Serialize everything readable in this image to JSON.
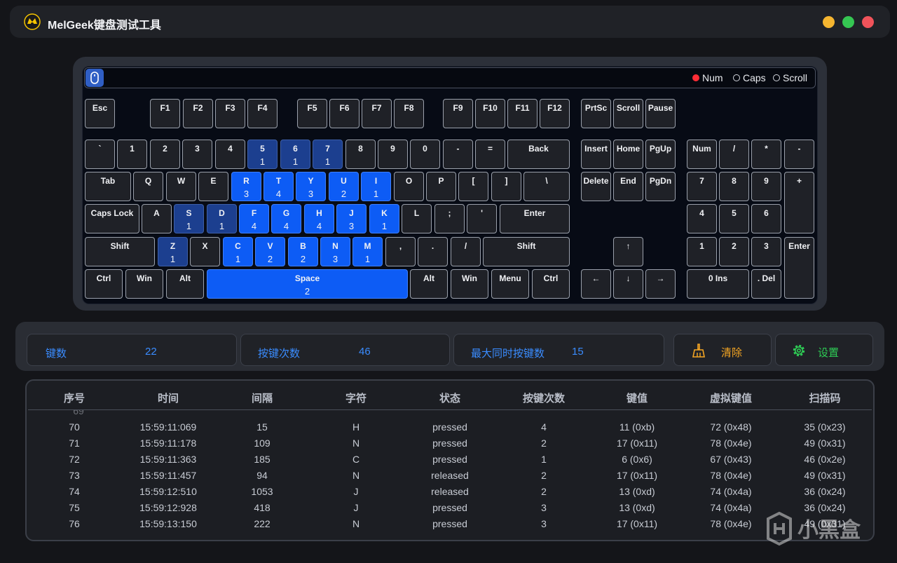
{
  "app": {
    "title": "MelGeek键盘测试工具"
  },
  "indicators": [
    {
      "label": "Num",
      "on": true
    },
    {
      "label": "Caps",
      "on": false
    },
    {
      "label": "Scroll",
      "on": false
    }
  ],
  "keys": [
    {
      "id": "esc",
      "label": "Esc"
    },
    {
      "id": "f1",
      "label": "F1"
    },
    {
      "id": "f2",
      "label": "F2"
    },
    {
      "id": "f3",
      "label": "F3"
    },
    {
      "id": "f4",
      "label": "F4"
    },
    {
      "id": "f5",
      "label": "F5"
    },
    {
      "id": "f6",
      "label": "F6"
    },
    {
      "id": "f7",
      "label": "F7"
    },
    {
      "id": "f8",
      "label": "F8"
    },
    {
      "id": "f9",
      "label": "F9"
    },
    {
      "id": "f10",
      "label": "F10"
    },
    {
      "id": "f11",
      "label": "F11"
    },
    {
      "id": "f12",
      "label": "F12"
    },
    {
      "id": "prtsc",
      "label": "PrtSc"
    },
    {
      "id": "scroll",
      "label": "Scroll"
    },
    {
      "id": "pause",
      "label": "Pause"
    },
    {
      "id": "grave",
      "label": "`"
    },
    {
      "id": "d1",
      "label": "1"
    },
    {
      "id": "d2",
      "label": "2"
    },
    {
      "id": "d3",
      "label": "3"
    },
    {
      "id": "d4",
      "label": "4"
    },
    {
      "id": "d5",
      "label": "5",
      "count": "1"
    },
    {
      "id": "d6",
      "label": "6",
      "count": "1"
    },
    {
      "id": "d7",
      "label": "7",
      "count": "1"
    },
    {
      "id": "d8",
      "label": "8"
    },
    {
      "id": "d9",
      "label": "9"
    },
    {
      "id": "d0",
      "label": "0"
    },
    {
      "id": "minus",
      "label": "-"
    },
    {
      "id": "equal",
      "label": "="
    },
    {
      "id": "back",
      "label": "Back"
    },
    {
      "id": "insert",
      "label": "Insert"
    },
    {
      "id": "home",
      "label": "Home"
    },
    {
      "id": "pgup",
      "label": "PgUp"
    },
    {
      "id": "numlock",
      "label": "Num"
    },
    {
      "id": "ndiv",
      "label": "/"
    },
    {
      "id": "nmul",
      "label": "*"
    },
    {
      "id": "nsub",
      "label": "-"
    },
    {
      "id": "tab",
      "label": "Tab"
    },
    {
      "id": "q",
      "label": "Q"
    },
    {
      "id": "w",
      "label": "W"
    },
    {
      "id": "e",
      "label": "E"
    },
    {
      "id": "r",
      "label": "R",
      "count": "3"
    },
    {
      "id": "t",
      "label": "T",
      "count": "4"
    },
    {
      "id": "y",
      "label": "Y",
      "count": "3"
    },
    {
      "id": "u",
      "label": "U",
      "count": "2"
    },
    {
      "id": "i",
      "label": "I",
      "count": "1"
    },
    {
      "id": "o",
      "label": "O"
    },
    {
      "id": "p",
      "label": "P"
    },
    {
      "id": "lbr",
      "label": "["
    },
    {
      "id": "rbr",
      "label": "]"
    },
    {
      "id": "bslash",
      "label": "\\"
    },
    {
      "id": "delete",
      "label": "Delete"
    },
    {
      "id": "end",
      "label": "End"
    },
    {
      "id": "pgdn",
      "label": "PgDn"
    },
    {
      "id": "n7",
      "label": "7"
    },
    {
      "id": "n8",
      "label": "8"
    },
    {
      "id": "n9",
      "label": "9"
    },
    {
      "id": "nadd",
      "label": "+"
    },
    {
      "id": "caps",
      "label": "Caps Lock"
    },
    {
      "id": "a",
      "label": "A"
    },
    {
      "id": "s",
      "label": "S",
      "count": "1"
    },
    {
      "id": "d",
      "label": "D",
      "count": "1"
    },
    {
      "id": "f",
      "label": "F",
      "count": "4"
    },
    {
      "id": "g",
      "label": "G",
      "count": "4"
    },
    {
      "id": "h",
      "label": "H",
      "count": "4"
    },
    {
      "id": "j",
      "label": "J",
      "count": "3"
    },
    {
      "id": "k",
      "label": "K",
      "count": "1"
    },
    {
      "id": "l",
      "label": "L"
    },
    {
      "id": "semi",
      "label": ";"
    },
    {
      "id": "quote",
      "label": "'"
    },
    {
      "id": "enter",
      "label": "Enter"
    },
    {
      "id": "n4",
      "label": "4"
    },
    {
      "id": "n5",
      "label": "5"
    },
    {
      "id": "n6",
      "label": "6"
    },
    {
      "id": "lshift",
      "label": "Shift"
    },
    {
      "id": "z",
      "label": "Z",
      "count": "1"
    },
    {
      "id": "x",
      "label": "X"
    },
    {
      "id": "c",
      "label": "C",
      "count": "1"
    },
    {
      "id": "v",
      "label": "V",
      "count": "2"
    },
    {
      "id": "b",
      "label": "B",
      "count": "2"
    },
    {
      "id": "n",
      "label": "N",
      "count": "3"
    },
    {
      "id": "m",
      "label": "M",
      "count": "1"
    },
    {
      "id": "comma",
      "label": ","
    },
    {
      "id": "period",
      "label": "."
    },
    {
      "id": "slash",
      "label": "/"
    },
    {
      "id": "rshift",
      "label": "Shift"
    },
    {
      "id": "up",
      "label": "↑"
    },
    {
      "id": "n1",
      "label": "1"
    },
    {
      "id": "n2",
      "label": "2"
    },
    {
      "id": "n3",
      "label": "3"
    },
    {
      "id": "nenter",
      "label": "Enter"
    },
    {
      "id": "lctrl",
      "label": "Ctrl"
    },
    {
      "id": "lwin",
      "label": "Win"
    },
    {
      "id": "lalt",
      "label": "Alt"
    },
    {
      "id": "space",
      "label": "Space",
      "count": "2"
    },
    {
      "id": "ralt",
      "label": "Alt"
    },
    {
      "id": "rwin",
      "label": "Win"
    },
    {
      "id": "menu",
      "label": "Menu"
    },
    {
      "id": "rctrl",
      "label": "Ctrl"
    },
    {
      "id": "left",
      "label": "←"
    },
    {
      "id": "down",
      "label": "↓"
    },
    {
      "id": "right",
      "label": "→"
    },
    {
      "id": "n0",
      "label": "0 Ins"
    },
    {
      "id": "ndel",
      "label": ". Del"
    }
  ],
  "stats": {
    "keys_label": "键数",
    "keys_value": "22",
    "presses_label": "按键次数",
    "presses_value": "46",
    "max_label": "最大同时按键数",
    "max_value": "15"
  },
  "actions": {
    "clear_label": "清除",
    "settings_label": "设置"
  },
  "colors": {
    "accent_blue": "#3a8cff",
    "clear_orange": "#f5a623",
    "settings_green": "#2ecc55"
  },
  "table": {
    "headers": [
      "序号",
      "时间",
      "间隔",
      "字符",
      "状态",
      "按键次数",
      "键值",
      "虚拟键值",
      "扫描码"
    ],
    "rows": [
      [
        "70",
        "15:59:11:069",
        "15",
        "H",
        "pressed",
        "4",
        "11 (0xb)",
        "72 (0x48)",
        "35 (0x23)"
      ],
      [
        "71",
        "15:59:11:178",
        "109",
        "N",
        "pressed",
        "2",
        "17 (0x11)",
        "78 (0x4e)",
        "49 (0x31)"
      ],
      [
        "72",
        "15:59:11:363",
        "185",
        "C",
        "pressed",
        "1",
        "6 (0x6)",
        "67 (0x43)",
        "46 (0x2e)"
      ],
      [
        "73",
        "15:59:11:457",
        "94",
        "N",
        "released",
        "2",
        "17 (0x11)",
        "78 (0x4e)",
        "49 (0x31)"
      ],
      [
        "74",
        "15:59:12:510",
        "1053",
        "J",
        "released",
        "2",
        "13 (0xd)",
        "74 (0x4a)",
        "36 (0x24)"
      ],
      [
        "75",
        "15:59:12:928",
        "418",
        "J",
        "pressed",
        "3",
        "13 (0xd)",
        "74 (0x4a)",
        "36 (0x24)"
      ],
      [
        "76",
        "15:59:13:150",
        "222",
        "N",
        "pressed",
        "3",
        "17 (0x11)",
        "78 (0x4e)",
        "49 (0x31)"
      ]
    ]
  },
  "watermark": {
    "text": "小黑盒"
  }
}
